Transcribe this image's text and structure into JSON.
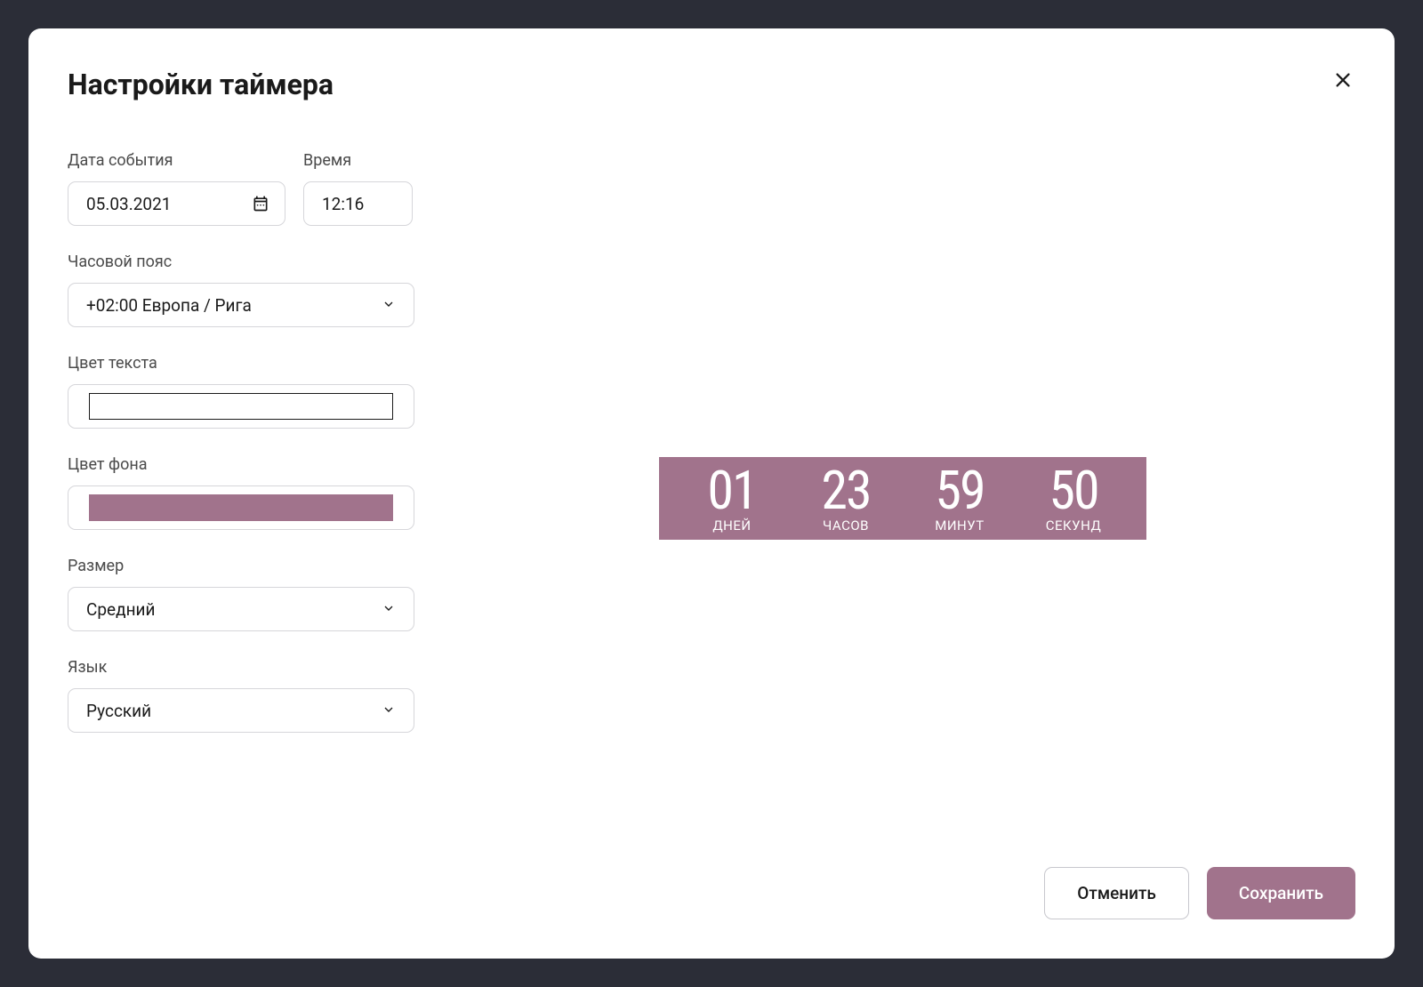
{
  "modal": {
    "title": "Настройки таймера"
  },
  "form": {
    "event_date": {
      "label": "Дата события",
      "value": "05.03.2021"
    },
    "event_time": {
      "label": "Время",
      "value": "12:16"
    },
    "timezone": {
      "label": "Часовой пояс",
      "value": "+02:00 Европа / Рига"
    },
    "text_color": {
      "label": "Цвет текста",
      "value": "#ffffff"
    },
    "bg_color": {
      "label": "Цвет фона",
      "value": "#a1738c"
    },
    "size": {
      "label": "Размер",
      "value": "Средний"
    },
    "language": {
      "label": "Язык",
      "value": "Русский"
    }
  },
  "preview": {
    "units": [
      {
        "value": "01",
        "label": "ДНЕЙ"
      },
      {
        "value": "23",
        "label": "ЧАСОВ"
      },
      {
        "value": "59",
        "label": "МИНУТ"
      },
      {
        "value": "50",
        "label": "СЕКУНД"
      }
    ]
  },
  "footer": {
    "cancel": "Отменить",
    "save": "Сохранить"
  },
  "colors": {
    "text_color_swatch": "#ffffff",
    "bg_color_swatch": "#a1738c"
  }
}
